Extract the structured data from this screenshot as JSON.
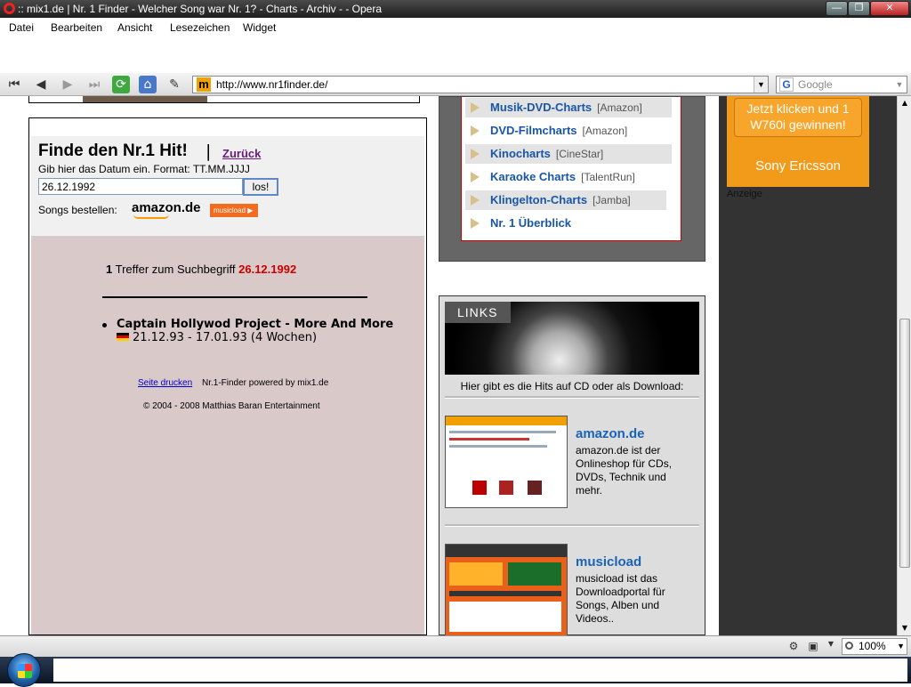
{
  "window": {
    "title": ":: mix1.de | Nr. 1 Finder - Welcher Song war Nr. 1? - Charts - Archiv - - Opera"
  },
  "menu": [
    "Datei",
    "Bearbeiten",
    "Ansicht",
    "Lesezeichen",
    "Widget"
  ],
  "address": {
    "url": "http://www.nr1finder.de/",
    "search_placeholder": "Google"
  },
  "finder": {
    "title": "Finde den Nr.1 Hit!",
    "separator": "|",
    "back_link": "Zurück",
    "date_hint": "Gib hier das Datum ein. Format: TT.MM.JJJJ",
    "date_value": "26.12.1992",
    "go_button": "los!",
    "order_label": "Songs bestellen:",
    "amazon_logo": "amazon.de",
    "musicload_logo": "musicload ▶"
  },
  "result": {
    "count": "1",
    "hit_text": "Treffer zum Suchbegriff",
    "term": "26.12.1992",
    "song": "Captain Hollywod Project - More And More",
    "dates": "21.12.93 - 17.01.93 (4 Wochen)",
    "print_link": "Seite drucken",
    "powered": "Nr.1-Finder powered by mix1.de",
    "copyright": "© 2004 - 2008 Matthias Baran Entertainment"
  },
  "charts": [
    {
      "name": "Musik-DVD-Charts",
      "source": "[Amazon]"
    },
    {
      "name": "DVD-Filmcharts",
      "source": "[Amazon]"
    },
    {
      "name": "Kinocharts",
      "source": "[CineStar]"
    },
    {
      "name": "Karaoke Charts",
      "source": "[TalentRun]"
    },
    {
      "name": "Klingelton-Charts",
      "source": "[Jamba]"
    },
    {
      "name": "Nr. 1 Überblick",
      "source": ""
    }
  ],
  "links": {
    "tab": "LINKS",
    "caption": "Hier gibt es die Hits auf CD oder als Download:",
    "shops": [
      {
        "name": "amazon.de",
        "desc": "amazon.de ist der Onlineshop für CDs, DVDs, Technik und mehr."
      },
      {
        "name": "musicload",
        "desc": "musicload ist das Downloadportal für Songs, Alben und Videos.."
      }
    ]
  },
  "ad": {
    "button": "Jetzt klicken und 1 W760i gewinnen!",
    "brand": "Sony Ericsson",
    "label": "Anzeige"
  },
  "status": {
    "zoom": "100%"
  }
}
